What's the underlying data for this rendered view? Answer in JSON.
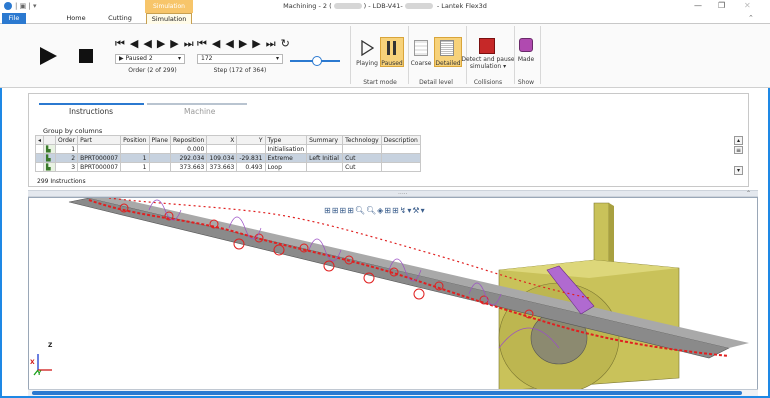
{
  "window": {
    "title_prefix": "Machining - 2 (",
    "title_middle": ") - LDB-V41-",
    "title_suffix": " - Lantek Flex3d",
    "context_tab": "Simulation"
  },
  "tabs": [
    "File",
    "Home",
    "Cutting",
    "Simulation"
  ],
  "ribbon": {
    "paused_dropdown": "Paused 2",
    "order_label": "Order (2 of 299)",
    "step_value": "172",
    "step_label": "Step (172 of 364)",
    "playing": "Playing",
    "paused": "Paused",
    "start_mode": "Start mode",
    "coarse": "Coarse",
    "detailed": "Detailed",
    "detail_level": "Detail level",
    "detect_pause_1": "Detect and pause",
    "detect_pause_2": "simulation ▾",
    "collisions": "Collisions",
    "made": "Made",
    "show": "Show"
  },
  "panel": {
    "tab_instructions": "Instructions",
    "tab_machine": "Machine",
    "group_by": "Group by columns",
    "columns": [
      "Order",
      "Part",
      "Position",
      "Plane",
      "Reposition",
      "X",
      "Y",
      "Type",
      "Summary",
      "Technology",
      "Description"
    ],
    "rows": [
      {
        "order": "1",
        "part": "",
        "position": "",
        "plane": "",
        "reposition": "0.000",
        "x": "",
        "y": "",
        "type": "Initialisation",
        "summary": "",
        "technology": "",
        "description": ""
      },
      {
        "order": "2",
        "part": "BPRT000007",
        "position": "1",
        "plane": "",
        "reposition": "292.034",
        "x": "109.034",
        "y": "-29.831",
        "type": "Extreme",
        "summary": "Left Initial",
        "technology": "Cut",
        "description": ""
      },
      {
        "order": "3",
        "part": "BPRT000007",
        "position": "1",
        "plane": "",
        "reposition": "373.663",
        "x": "373.663",
        "y": "0.493",
        "type": "Loop",
        "summary": "",
        "technology": "Cut",
        "description": ""
      }
    ],
    "count": "299 Instructions"
  },
  "axes": {
    "z": "Z",
    "x": "X",
    "y": "Y"
  },
  "colors": {
    "accent": "#2b79d0",
    "context": "#f7c56a",
    "torch": "#e02020",
    "tube": "#8a8a8a",
    "chuck": "#c9c25a",
    "purple": "#9b4fc4"
  }
}
